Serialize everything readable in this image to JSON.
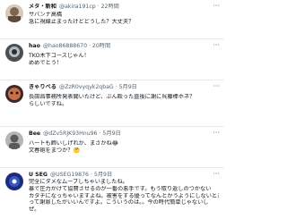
{
  "tweets": [
    {
      "name": "メタ・新和",
      "handle": "@akira191cp · 22時間",
      "lines": [
        "サバンナ高橋",
        "急に視線止まったけどどうした？大丈夫？"
      ],
      "avatar_color": "#c9b9a8"
    },
    {
      "name": "hao",
      "handle": "@hao86888670 · 20時間",
      "lines": [
        "TKO木下コースじゃん！",
        "めめでとう！"
      ],
      "avatar_color": "#8a8f96"
    },
    {
      "name": "きゃりべる",
      "handle": "@ZzR0vyqyk2qbaG · 5月9日",
      "lines": [
        "長田昌事務所発表聞いたけど、ぶん殴った直後に謝に呉藤棒ホネ？",
        "らしいですね。"
      ],
      "avatar_color": "#6b3e2e"
    },
    {
      "name": "Bee",
      "handle": "@dZv5RJK93Hnu96 · 5月9日",
      "lines": [
        "ハートも飾いしげれか、まさかね😂",
        "文春砲をまつか？🤔"
      ],
      "avatar_color": "#9a9a9a"
    },
    {
      "name": "U SEG",
      "handle": "@USEG19876 · 5月9日",
      "lines": [
        "完全にダメなムーブしちゃいましたね。",
        "暴で圧力かけて協賛させるのが一番の悪手です。もう取り返しのつかない",
        "カタチになっちゃいますよね。被害をする優ってなんとかうようにしないとき",
        "って謝罪したがいいんですよ。こういうのは。。今の時代簡単じゃないし",
        "ぜ。"
      ],
      "avatar_color": "#1b2d7a"
    }
  ],
  "more_glyph": "···"
}
